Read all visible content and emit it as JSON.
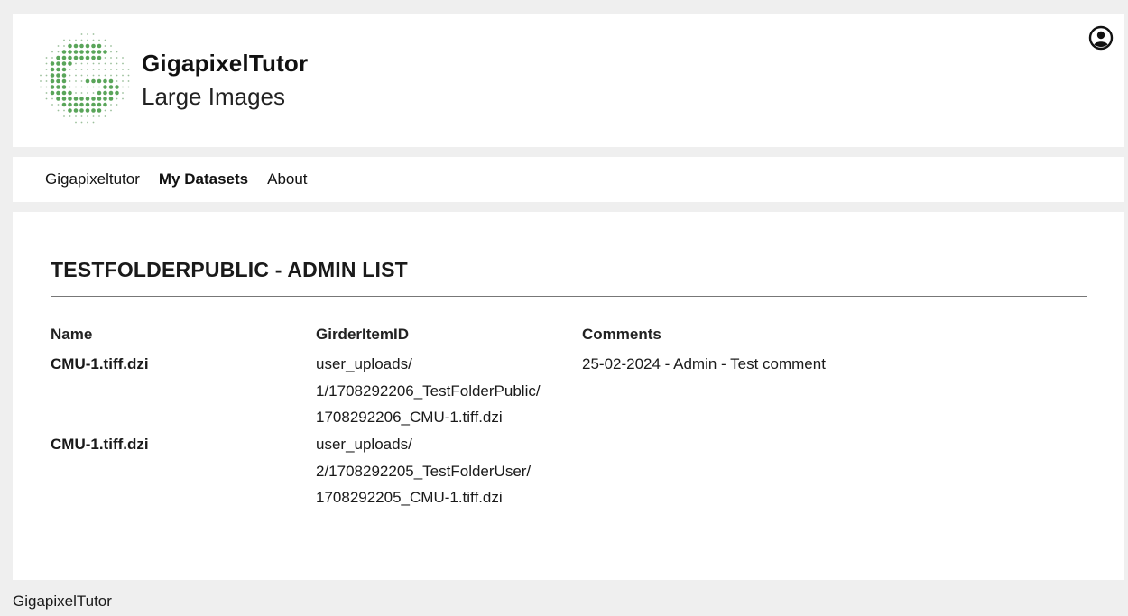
{
  "header": {
    "brand_title": "GigapixelTutor",
    "brand_subtitle": "Large Images",
    "logo_icon": "dotted-circle-logo-icon",
    "user_icon": "user-circle-icon",
    "accent_color": "#5aa55a"
  },
  "nav": {
    "items": [
      {
        "label": "Gigapixeltutor",
        "active": false
      },
      {
        "label": "My Datasets",
        "active": true
      },
      {
        "label": "About",
        "active": false
      }
    ]
  },
  "main": {
    "title": "TESTFOLDERPUBLIC - ADMIN LIST",
    "columns": {
      "name": "Name",
      "girder": "GirderItemID",
      "comments": "Comments"
    },
    "rows": [
      {
        "name": "CMU-1.tiff.dzi",
        "girder_lines": [
          "user_uploads/",
          "1/1708292206_TestFolderPublic/",
          "1708292206_CMU-1.tiff.dzi"
        ],
        "comment": "25-02-2024 - Admin - Test comment"
      },
      {
        "name": "CMU-1.tiff.dzi",
        "girder_lines": [
          "user_uploads/",
          "2/1708292205_TestFolderUser/",
          "1708292205_CMU-1.tiff.dzi"
        ],
        "comment": ""
      }
    ]
  },
  "footer": {
    "text": "GigapixelTutor"
  }
}
